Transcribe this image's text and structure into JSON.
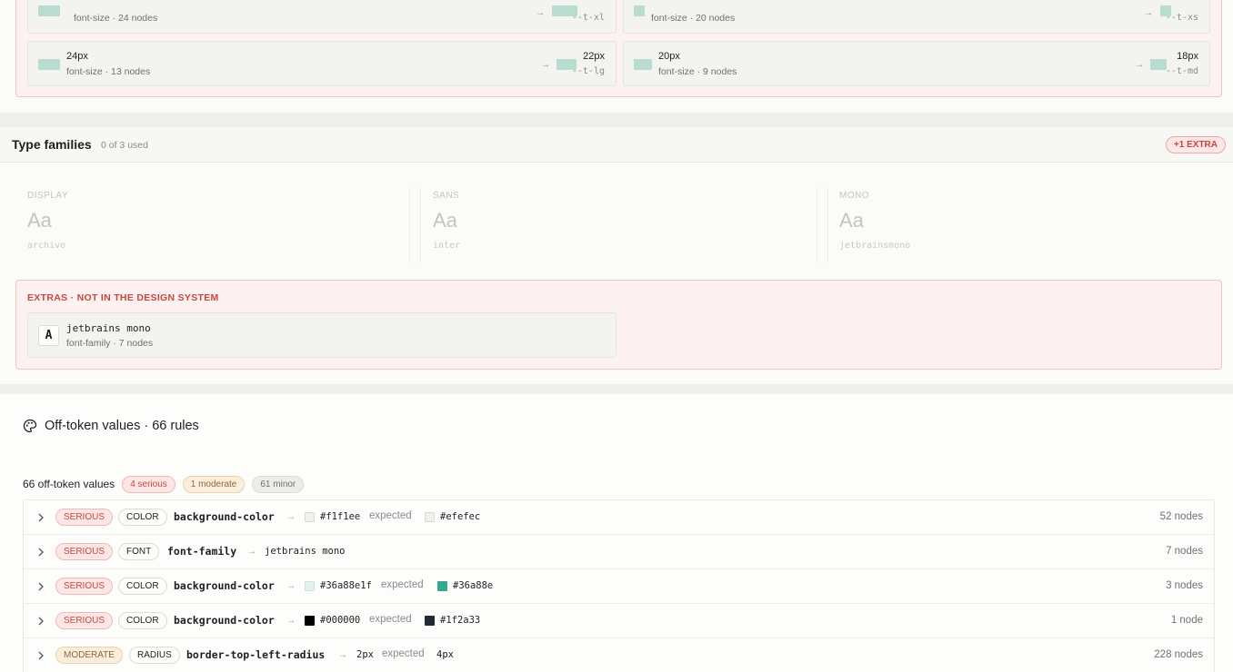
{
  "font_size_extras": [
    {
      "value": "",
      "meta": "font-size · 24 nodes",
      "token_value": "",
      "token": "--t-xl"
    },
    {
      "value": "",
      "meta": "font-size · 20 nodes",
      "token_value": "",
      "token": "--t-xs"
    },
    {
      "value": "24px",
      "meta": "font-size · 13 nodes",
      "token_value": "22px",
      "token": "--t-lg"
    },
    {
      "value": "20px",
      "meta": "font-size · 9 nodes",
      "token_value": "18px",
      "token": "--t-md"
    }
  ],
  "arrow": "→",
  "type_families": {
    "title": "Type families",
    "used": "0 of 3 used",
    "extra_badge": "+1 EXTRA",
    "families": [
      {
        "label": "DISPLAY",
        "sample": "Aa",
        "name": "archivo"
      },
      {
        "label": "SANS",
        "sample": "Aa",
        "name": "inter"
      },
      {
        "label": "MONO",
        "sample": "Aa",
        "name": "jetbrainsmono"
      }
    ],
    "extras_title": "EXTRAS · NOT IN THE DESIGN SYSTEM",
    "extra_item": {
      "glyph": "A",
      "name": "jetbrains mono",
      "meta": "font-family · 7 nodes"
    }
  },
  "off_token": {
    "title": "Off-token values · 66 rules",
    "count_label": "66 off-token values",
    "pills": {
      "serious": "4 serious",
      "moderate": "1 moderate",
      "minor": "61 minor"
    },
    "expected_label": "expected",
    "rules": [
      {
        "severity": "SERIOUS",
        "category": "COLOR",
        "property": "background-color",
        "value": "#f1f1ee",
        "value_color": "#f1f1ee",
        "expected": "#efefec",
        "expected_color": "#efefec",
        "nodes": "52 nodes"
      },
      {
        "severity": "SERIOUS",
        "category": "FONT",
        "property": "font-family",
        "value": "jetbrains mono",
        "nodes": "7 nodes"
      },
      {
        "severity": "SERIOUS",
        "category": "COLOR",
        "property": "background-color",
        "value": "#36a88e1f",
        "value_color": "#e4f2ee",
        "expected": "#36a88e",
        "expected_color": "#36a88e",
        "nodes": "3 nodes"
      },
      {
        "severity": "SERIOUS",
        "category": "COLOR",
        "property": "background-color",
        "value": "#000000",
        "value_color": "#000000",
        "expected": "#1f2a33",
        "expected_color": "#1f2a33",
        "nodes": "1 node"
      },
      {
        "severity": "MODERATE",
        "category": "RADIUS",
        "property": "border-top-left-radius",
        "value": "2px",
        "expected": "4px",
        "nodes": "228 nodes"
      }
    ]
  }
}
